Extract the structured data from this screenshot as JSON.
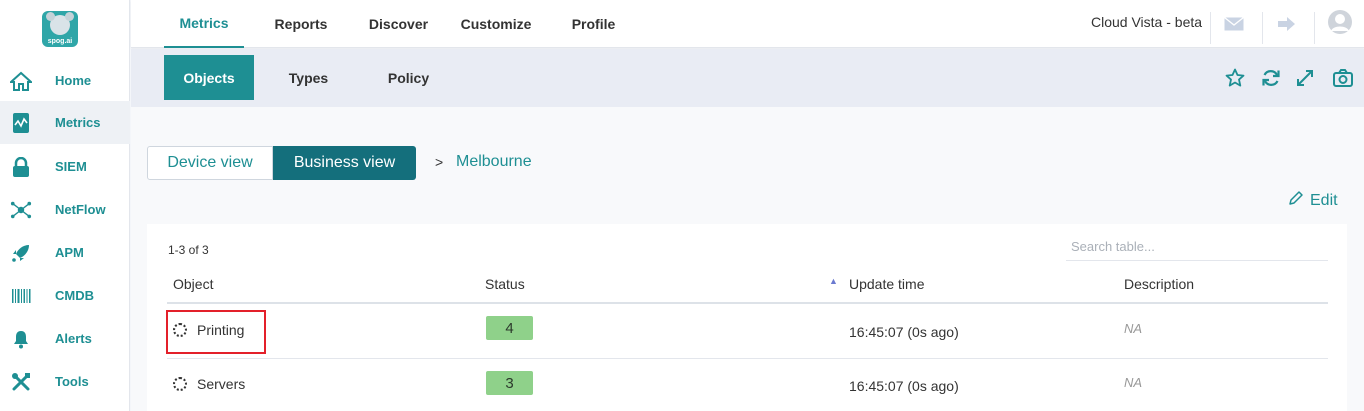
{
  "sidebar": {
    "logo_text": "spog.ai",
    "items": [
      {
        "label": "Home",
        "icon": "home-icon"
      },
      {
        "label": "Metrics",
        "icon": "metrics-icon"
      },
      {
        "label": "SIEM",
        "icon": "lock-icon"
      },
      {
        "label": "NetFlow",
        "icon": "netflow-icon"
      },
      {
        "label": "APM",
        "icon": "rocket-icon"
      },
      {
        "label": "CMDB",
        "icon": "barcode-icon"
      },
      {
        "label": "Alerts",
        "icon": "bell-icon"
      },
      {
        "label": "Tools",
        "icon": "tools-icon"
      }
    ],
    "active_index": 1
  },
  "topnav": {
    "tabs": [
      "Metrics",
      "Reports",
      "Discover",
      "Customize",
      "Profile"
    ],
    "active": "Metrics",
    "org_name": "Cloud Vista - beta"
  },
  "subnav": {
    "tabs": [
      "Objects",
      "Types",
      "Policy"
    ],
    "active": "Objects",
    "tools": [
      "star-icon",
      "refresh-icon",
      "expand-icon",
      "camera-icon"
    ]
  },
  "view_toggle": {
    "device_label": "Device view",
    "business_label": "Business view",
    "active": "Business view"
  },
  "breadcrumb": {
    "separator": ">",
    "current": "Melbourne"
  },
  "edit_label": "Edit",
  "table": {
    "count_text": "1-3 of 3",
    "search_placeholder": "Search table...",
    "columns": [
      "Object",
      "Status",
      "Update time",
      "Description"
    ],
    "sorted_column": "Update time",
    "rows": [
      {
        "object": "Printing",
        "status": "4",
        "update_time": "16:45:07 (0s ago)",
        "description": "NA"
      },
      {
        "object": "Servers",
        "status": "3",
        "update_time": "16:45:07 (0s ago)",
        "description": "NA"
      }
    ]
  },
  "colors": {
    "accent": "#1e8f93",
    "accent_dark": "#146f7c",
    "status_ok": "#8fd18a",
    "highlight": "#e3202a"
  }
}
